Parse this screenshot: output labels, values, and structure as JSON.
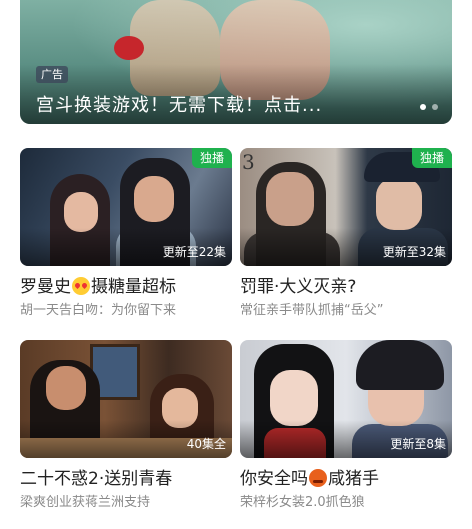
{
  "banner": {
    "ad_label": "广告",
    "title": "宫斗换装游戏！无需下载！点击...",
    "page_count": 2,
    "active_page": 1
  },
  "cards": [
    {
      "badge": "独播",
      "episodes": "更新至22集",
      "title_before": "罗曼史",
      "emoji": "heart-eyes-emoji",
      "title_after": "摄糖量超标",
      "subtitle": "胡一天告白吻：为你留下来"
    },
    {
      "badge": "独播",
      "episodes": "更新至32集",
      "title_before": "罚罪·大义灭亲?",
      "emoji": "",
      "title_after": "",
      "subtitle": "常征亲手带队抓捕“岳父”",
      "poster_number": "3"
    },
    {
      "badge": "",
      "episodes": "40集全",
      "title_before": "二十不惑2·送别青春",
      "emoji": "",
      "title_after": "",
      "subtitle": "梁爽创业获蒋兰洲支持"
    },
    {
      "badge": "",
      "episodes": "更新至8集",
      "title_before": "你安全吗",
      "emoji": "angry-face-emoji",
      "title_after": "咸猪手",
      "subtitle": "荣梓杉女装2.0抓色狼"
    }
  ],
  "colors": {
    "exclusive_badge": "#1fb14e",
    "title_text": "#222222",
    "subtitle_text": "#8a8a8a"
  }
}
